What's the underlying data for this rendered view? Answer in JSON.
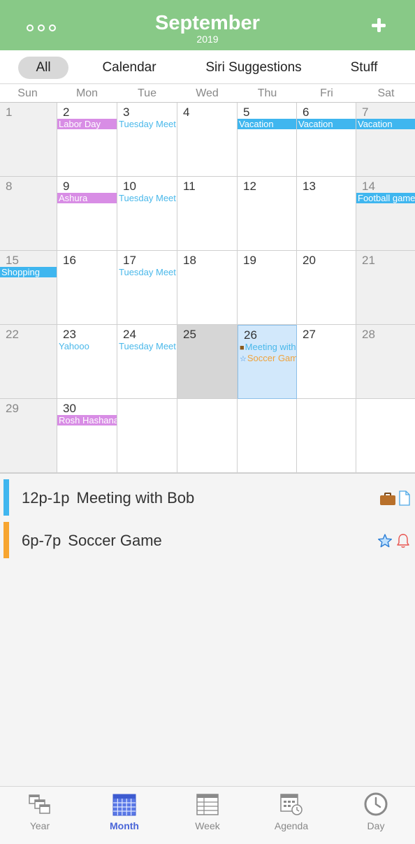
{
  "header": {
    "title": "September",
    "year": "2019",
    "more_icon": "ellipsis-icon",
    "add_icon": "plus-icon"
  },
  "filters": [
    "All",
    "Calendar",
    "Siri Suggestions",
    "Stuff"
  ],
  "active_filter": "All",
  "weekdays": [
    "Sun",
    "Mon",
    "Tue",
    "Wed",
    "Thu",
    "Fri",
    "Sat"
  ],
  "weeks": [
    [
      "1",
      "2",
      "3",
      "4",
      "5",
      "6",
      "7"
    ],
    [
      "8",
      "9",
      "10",
      "11",
      "12",
      "13",
      "14"
    ],
    [
      "15",
      "16",
      "17",
      "18",
      "19",
      "20",
      "21"
    ],
    [
      "22",
      "23",
      "24",
      "25",
      "26",
      "27",
      "28"
    ],
    [
      "29",
      "30",
      "",
      "",
      "",
      "",
      ""
    ]
  ],
  "events": {
    "labor_day": "Labor Day",
    "tuesday_meet": "Tuesday Meet",
    "vacation": "Vacation",
    "ashura": "Ashura",
    "football": "Football game",
    "shopping": "Shopping",
    "yahooo": "Yahooo",
    "meeting_short": "Meeting with Bob",
    "soccer_short": "Soccer Game",
    "rosh": "Rosh Hashana"
  },
  "agenda": [
    {
      "time": "12p-1p",
      "title": "Meeting with Bob",
      "color": "#3fb6ef",
      "icons": [
        "briefcase-icon",
        "document-icon"
      ]
    },
    {
      "time": "6p-7p",
      "title": "Soccer Game",
      "color": "#f7a530",
      "icons": [
        "star-icon",
        "bell-icon"
      ]
    }
  ],
  "colors": {
    "header": "#88c987",
    "holiday": "#d88de5",
    "event": "#3fb6ef",
    "selected": "#d2e8fb",
    "tab_active": "#4a66d8"
  },
  "tabs": [
    {
      "label": "Year",
      "icon": "year-calendar-icon"
    },
    {
      "label": "Month",
      "icon": "month-calendar-icon"
    },
    {
      "label": "Week",
      "icon": "week-calendar-icon"
    },
    {
      "label": "Agenda",
      "icon": "agenda-calendar-icon"
    },
    {
      "label": "Day",
      "icon": "clock-icon"
    }
  ],
  "active_tab": "Month"
}
